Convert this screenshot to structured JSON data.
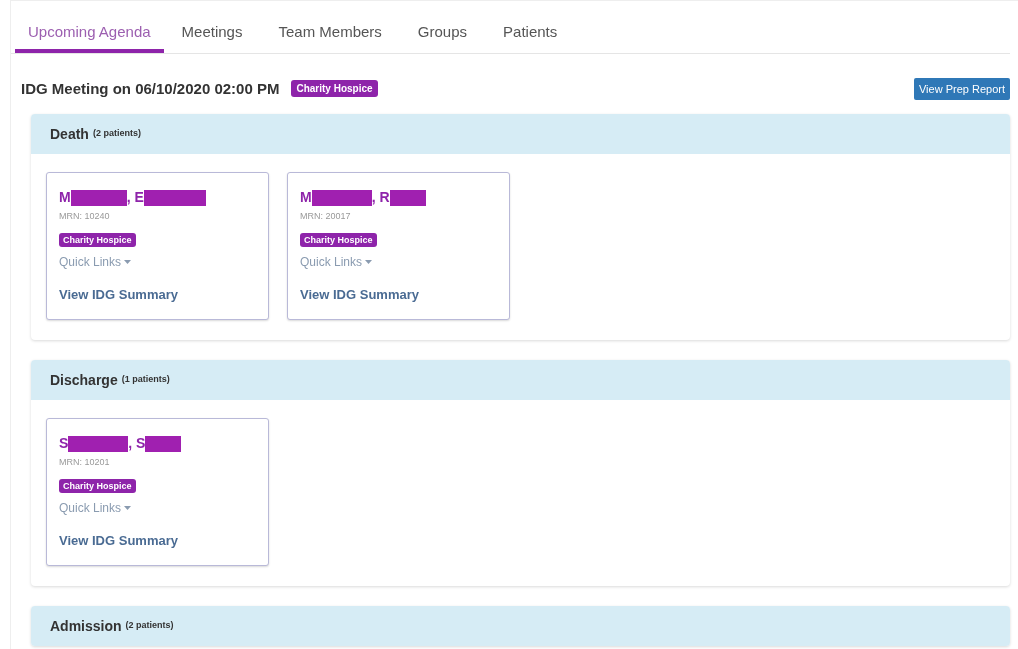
{
  "tabs": [
    {
      "label": "Upcoming Agenda",
      "selected": true
    },
    {
      "label": "Meetings",
      "selected": false
    },
    {
      "label": "Team Members",
      "selected": false
    },
    {
      "label": "Groups",
      "selected": false
    },
    {
      "label": "Patients",
      "selected": false
    }
  ],
  "meeting": {
    "title": "IDG Meeting on 06/10/2020 02:00 PM",
    "badge": "Charity Hospice",
    "button": "View Prep Report"
  },
  "sections": [
    {
      "title": "Death",
      "count": "(2 patients)",
      "patients": [
        {
          "name_parts": [
            "M",
            ", E"
          ],
          "mrn": "MRN: 10240",
          "badge": "Charity Hospice",
          "quick_links": "Quick Links",
          "summary": "View IDG Summary"
        },
        {
          "name_parts": [
            "M",
            ", R"
          ],
          "mrn": "MRN: 20017",
          "badge": "Charity Hospice",
          "quick_links": "Quick Links",
          "summary": "View IDG Summary"
        }
      ]
    },
    {
      "title": "Discharge",
      "count": "(1 patients)",
      "patients": [
        {
          "name_parts": [
            "S",
            ", S"
          ],
          "mrn": "MRN: 10201",
          "badge": "Charity Hospice",
          "quick_links": "Quick Links",
          "summary": "View IDG Summary"
        }
      ]
    },
    {
      "title": "Admission",
      "count": "(2 patients)"
    }
  ]
}
